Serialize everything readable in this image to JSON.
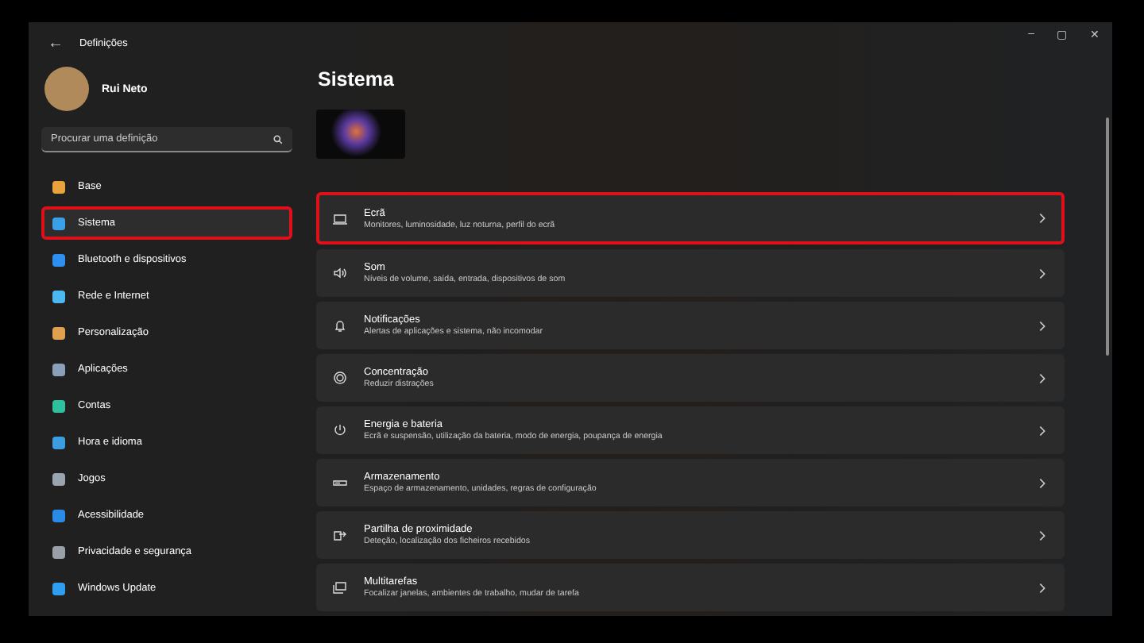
{
  "window": {
    "title": "Definições",
    "back": "←",
    "controls": [
      "–",
      "▢",
      "✕"
    ]
  },
  "user": {
    "name": "Rui Neto"
  },
  "search": {
    "placeholder": "Procurar uma definição"
  },
  "sidebar": {
    "items": [
      {
        "label": "Base",
        "selected": false,
        "highlighted": false,
        "color": "#e8a33d"
      },
      {
        "label": "Sistema",
        "selected": true,
        "highlighted": true,
        "color": "#3aa0e8"
      },
      {
        "label": "Bluetooth e dispositivos",
        "selected": false,
        "highlighted": false,
        "color": "#2f8ff0"
      },
      {
        "label": "Rede e Internet",
        "selected": false,
        "highlighted": false,
        "color": "#4cb8f0"
      },
      {
        "label": "Personalização",
        "selected": false,
        "highlighted": false,
        "color": "#e0a050"
      },
      {
        "label": "Aplicações",
        "selected": false,
        "highlighted": false,
        "color": "#8aa0b8"
      },
      {
        "label": "Contas",
        "selected": false,
        "highlighted": false,
        "color": "#2fc0a0"
      },
      {
        "label": "Hora e idioma",
        "selected": false,
        "highlighted": false,
        "color": "#3a9ee0"
      },
      {
        "label": "Jogos",
        "selected": false,
        "highlighted": false,
        "color": "#9aa4ae"
      },
      {
        "label": "Acessibilidade",
        "selected": false,
        "highlighted": false,
        "color": "#2a8ae8"
      },
      {
        "label": "Privacidade e segurança",
        "selected": false,
        "highlighted": false,
        "color": "#9aa0a8"
      },
      {
        "label": "Windows Update",
        "selected": false,
        "highlighted": false,
        "color": "#2f9ef0"
      }
    ]
  },
  "main": {
    "title": "Sistema",
    "cards": [
      {
        "title": "Ecrã",
        "subtitle": "Monitores, luminosidade, luz noturna, perfil do ecrã",
        "highlighted": true
      },
      {
        "title": "Som",
        "subtitle": "Níveis de volume, saída, entrada, dispositivos de som",
        "highlighted": false
      },
      {
        "title": "Notificações",
        "subtitle": "Alertas de aplicações e sistema, não incomodar",
        "highlighted": false
      },
      {
        "title": "Concentração",
        "subtitle": "Reduzir distrações",
        "highlighted": false
      },
      {
        "title": "Energia e bateria",
        "subtitle": "Ecrã e suspensão, utilização da bateria, modo de energia, poupança de energia",
        "highlighted": false
      },
      {
        "title": "Armazenamento",
        "subtitle": "Espaço de armazenamento, unidades, regras de configuração",
        "highlighted": false
      },
      {
        "title": "Partilha de proximidade",
        "subtitle": "Deteção, localização dos ficheiros recebidos",
        "highlighted": false
      },
      {
        "title": "Multitarefas",
        "subtitle": "Focalizar janelas, ambientes de trabalho, mudar de tarefa",
        "highlighted": false
      }
    ]
  }
}
